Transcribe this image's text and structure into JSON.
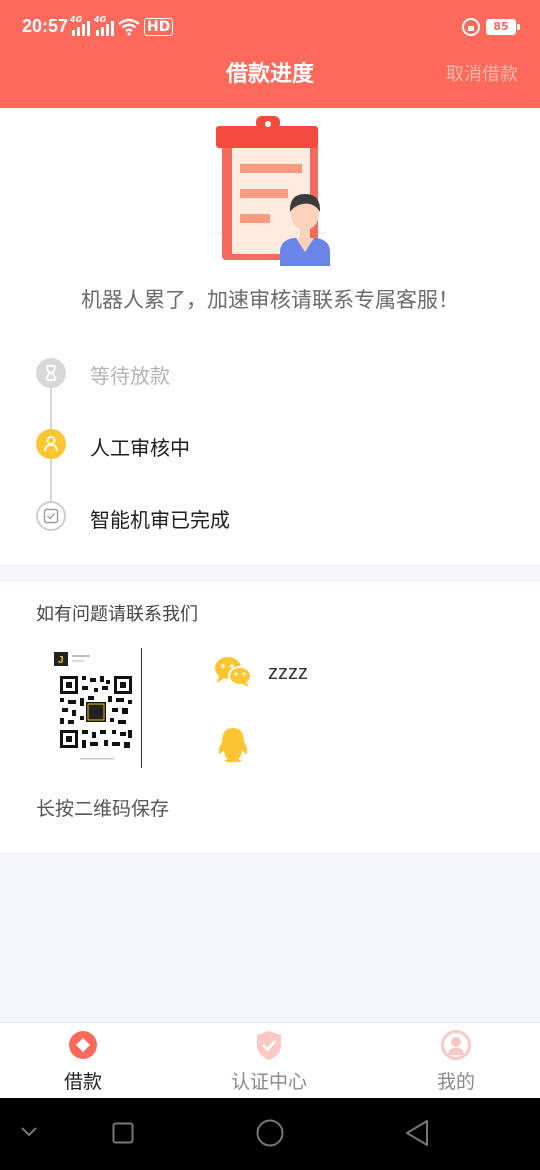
{
  "status_bar": {
    "time": "20:57",
    "signal1_label": "4G",
    "signal2_label": "4G",
    "hd_label": "HD",
    "battery": "85"
  },
  "header": {
    "title": "借款进度",
    "cancel_label": "取消借款"
  },
  "message": "机器人累了，加速审核请联系专属客服！",
  "steps": [
    {
      "label": "等待放款",
      "state": "pending",
      "icon": "hourglass-icon"
    },
    {
      "label": "人工审核中",
      "state": "current",
      "icon": "person-icon"
    },
    {
      "label": "智能机审已完成",
      "state": "done",
      "icon": "check-box-icon"
    }
  ],
  "contact": {
    "title": "如有问题请联系我们",
    "wechat_id": "zzzz",
    "save_hint": "长按二维码保存",
    "qr_logo_letter": "J"
  },
  "tabs": [
    {
      "label": "借款",
      "icon": "loan-icon",
      "active": true
    },
    {
      "label": "认证中心",
      "icon": "shield-check-icon",
      "active": false
    },
    {
      "label": "我的",
      "icon": "profile-icon",
      "active": false
    }
  ],
  "colors": {
    "primary": "#fd6a5c",
    "current_step": "#fcc633",
    "pending_step": "#d8d8d8",
    "wechat_qq": "#fcc633",
    "tab_inactive_icon": "#fbc9c3"
  }
}
